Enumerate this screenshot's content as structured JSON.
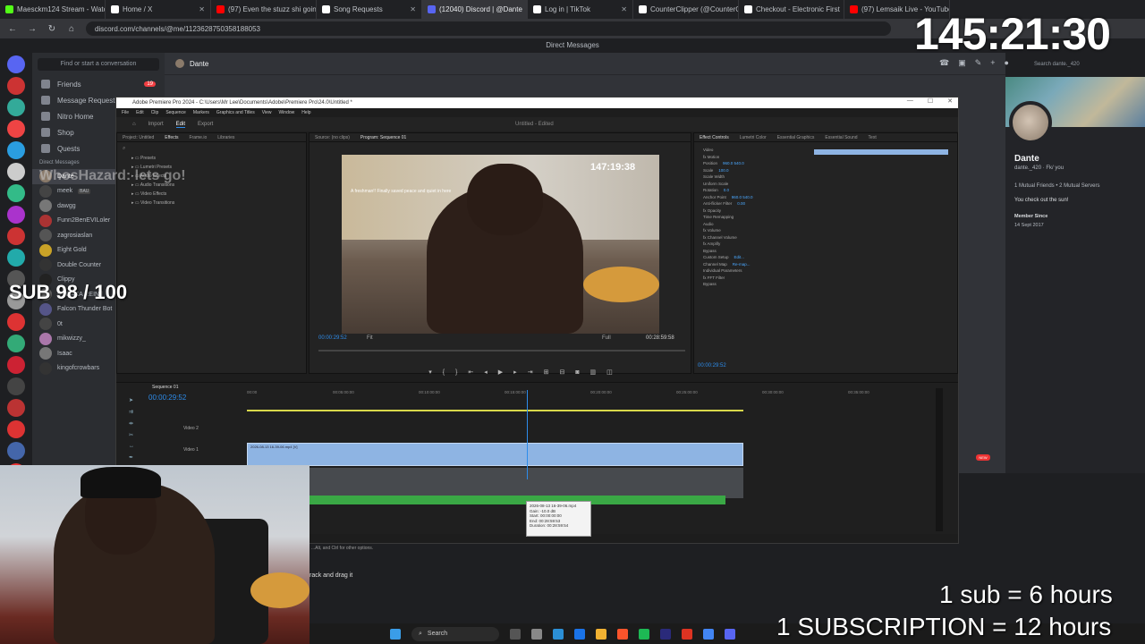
{
  "browser": {
    "tabs": [
      {
        "label": "Maesckm124 Stream - Watch",
        "color": "#53fc18"
      },
      {
        "label": "Home / X",
        "color": "#ffffff"
      },
      {
        "label": "(97) Even the stuzz shi goin",
        "color": "#ff0000"
      },
      {
        "label": "Song Requests",
        "color": "#ffffff"
      },
      {
        "label": "(12040) Discord | @Dante",
        "color": "#5865f2"
      },
      {
        "label": "Log in | TikTok",
        "color": "#ffffff"
      },
      {
        "label": "CounterClipper (@CounterCli",
        "color": "#ffffff"
      },
      {
        "label": "Checkout - Electronic First",
        "color": "#ffffff"
      },
      {
        "label": "(97) Lemsaik Live - YouTube",
        "color": "#ff0000"
      }
    ],
    "url": "discord.com/channels/@me/1123628750358188053"
  },
  "discord": {
    "window_title": "Direct Messages",
    "find_placeholder": "Find or start a conversation",
    "nav": [
      {
        "label": "Friends",
        "badge": "19"
      },
      {
        "label": "Message Requests",
        "badge": ""
      },
      {
        "label": "Nitro Home",
        "badge": ""
      },
      {
        "label": "Shop",
        "badge": ""
      },
      {
        "label": "Quests",
        "badge": ""
      }
    ],
    "dm_header": "Direct Messages",
    "dms": [
      {
        "name": "Dante",
        "color": "#8a7a6a"
      },
      {
        "name": "meek",
        "tag": "BAU",
        "color": "#444"
      },
      {
        "name": "dawgg",
        "color": "#777"
      },
      {
        "name": "Funn2BenEVILoler",
        "color": "#a33"
      },
      {
        "name": "zagrosiaslan",
        "color": "#555"
      },
      {
        "name": "Eight Gold",
        "color": "#c9a227"
      },
      {
        "name": "Double Counter",
        "color": "#333"
      },
      {
        "name": "Clippy",
        "color": "#222"
      },
      {
        "name": "!! [ DAKA REIN ]",
        "color": "#666"
      },
      {
        "name": "Falcon Thunder Bot",
        "color": "#558"
      },
      {
        "name": "0t",
        "color": "#444"
      },
      {
        "name": "mikwizzy_",
        "color": "#a7a"
      },
      {
        "name": "Isaac",
        "color": "#777"
      },
      {
        "name": "kingofcrowbars",
        "color": "#333"
      }
    ],
    "chat_header": "Dante",
    "search_placeholder": "Search dante._420",
    "profile": {
      "name": "Dante",
      "handle": "dante._420 · Fk/ you",
      "mutuals": "1 Mutual Friends • 2 Mutual Servers",
      "bio": "You check out the sun!",
      "member_since_label": "Member Since",
      "member_since": "14 Sept 2017"
    }
  },
  "premiere": {
    "title": "Adobe Premiere Pro 2024 - C:\\Users\\Mr Lee\\Documents\\Adobe\\Premiere Pro\\24.0\\Untitled *",
    "menu": [
      "File",
      "Edit",
      "Clip",
      "Sequence",
      "Markers",
      "Graphics and Titles",
      "View",
      "Window",
      "Help"
    ],
    "workspace_tabs": [
      "Import",
      "Edit",
      "Export"
    ],
    "active_workspace": "Edit",
    "project_name": "Untitled - Edited",
    "left_tabs": [
      "Project: Untitled",
      "Effects",
      "Frame.io",
      "Libraries"
    ],
    "effects_folders": [
      "Presets",
      "Lumetri Presets",
      "Audio Effects",
      "Audio Transitions",
      "Video Effects",
      "Video Transitions"
    ],
    "source_tab": "Source: (no clips)",
    "program_tab": "Program: Sequence 01",
    "program_timecode": "00:00:29:52",
    "program_fit": "Fit",
    "program_quality": "Full",
    "program_duration": "00:28:59:58",
    "video_overlay_timer": "147:19:38",
    "video_caption": "A freshman!! Finally saved peace and quiet in here",
    "right_tabs": [
      "Effect Controls",
      "Lumetri Color",
      "Essential Graphics",
      "Essential Sound",
      "Text"
    ],
    "effect_rows": [
      {
        "label": "Video",
        "value": ""
      },
      {
        "label": "fx Motion",
        "value": ""
      },
      {
        "label": "Position",
        "value": "960.0   540.0"
      },
      {
        "label": "Scale",
        "value": "100.0"
      },
      {
        "label": "Scale Width",
        "value": ""
      },
      {
        "label": "Uniform Scale",
        "value": ""
      },
      {
        "label": "Rotation",
        "value": "0.0"
      },
      {
        "label": "Anchor Point",
        "value": "960.0   540.0"
      },
      {
        "label": "Anti-flicker Filter",
        "value": "0.00"
      },
      {
        "label": "fx Opacity",
        "value": ""
      },
      {
        "label": "Time Remapping",
        "value": ""
      },
      {
        "label": "Audio",
        "value": ""
      },
      {
        "label": "fx Volume",
        "value": ""
      },
      {
        "label": "fx Channel Volume",
        "value": ""
      },
      {
        "label": "fx Amplify",
        "value": ""
      },
      {
        "label": "Bypass",
        "value": ""
      },
      {
        "label": "Custom Setup",
        "value": "Edit..."
      },
      {
        "label": "Channel Map",
        "value": "Re-map..."
      },
      {
        "label": "Individual Parameters",
        "value": ""
      },
      {
        "label": "fx FFT Filter",
        "value": ""
      },
      {
        "label": "Bypass",
        "value": ""
      }
    ],
    "effect_controls_timecode": "00:00:29:52",
    "sequence_tab": "Sequence 01",
    "timeline_timecode": "00:00:29:52",
    "ruler": [
      "00:00",
      "00:05:00:00",
      "00:10:00:00",
      "00:15:00:00",
      "00:20:00:00",
      "00:25:00:00",
      "00:30:00:00",
      "00:35:00:00"
    ],
    "tracks": [
      "Video 2",
      "Video 1",
      "A1"
    ],
    "clip_name": "2026-08-13 16-39-06.mp4 [V]",
    "tooltip": {
      "name": "2026-08-13 16-39-06.mp4",
      "gain": "Gain: -10.0 dB",
      "start": "Start: 00:00:00:00",
      "end": "End: 00:28:59:53",
      "duration": "Duration: 00:28:59:54"
    },
    "status_hint": "...Alt, and Ctrl for other options.",
    "new_badge": "NEW"
  },
  "stream_overlay": {
    "timer": "145:21:30",
    "sub_goal": "SUB 98 / 100",
    "whoshazard": "WhosHazard: lets go!",
    "rate1": "1 sub = 6 hours",
    "rate2": "1 SUBSCRIPTION = 12 hours",
    "drag_hint": "rack and drag it"
  },
  "taskbar": {
    "search_label": "Search"
  }
}
